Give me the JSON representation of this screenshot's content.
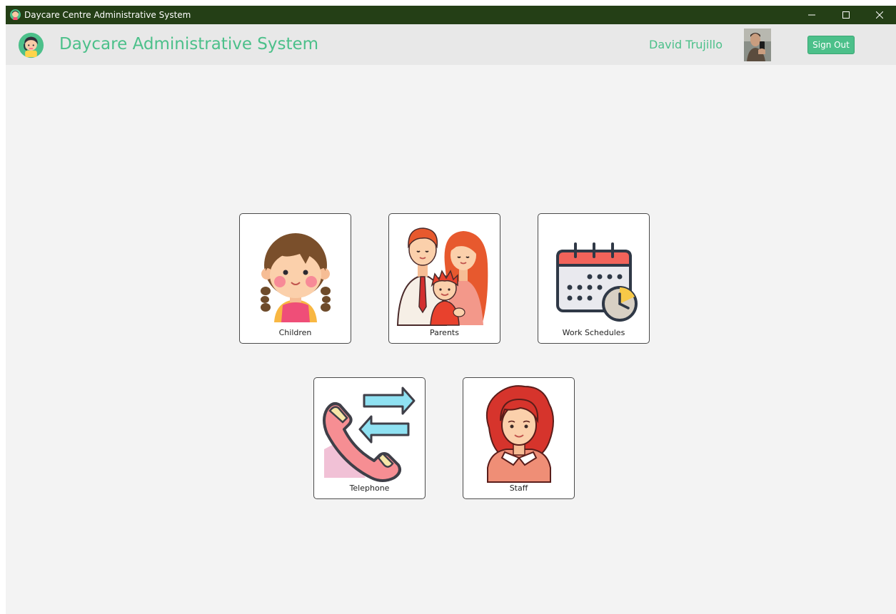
{
  "window": {
    "title": "Daycare Centre Administrative System"
  },
  "header": {
    "app_title": "Daycare Administrative System",
    "user_name": "David Trujillo",
    "sign_out_label": "Sign Out"
  },
  "tiles": [
    {
      "label": "Children",
      "icon": "child-girl-icon"
    },
    {
      "label": "Parents",
      "icon": "family-icon"
    },
    {
      "label": "Work Schedules",
      "icon": "calendar-clock-icon"
    },
    {
      "label": "Telephone",
      "icon": "telephone-transfer-icon"
    },
    {
      "label": "Staff",
      "icon": "staff-woman-icon"
    }
  ],
  "colors": {
    "titlebar": "#243f16",
    "accent": "#4cc08a",
    "background": "#f3f3f3",
    "header": "#e8e8e8"
  }
}
